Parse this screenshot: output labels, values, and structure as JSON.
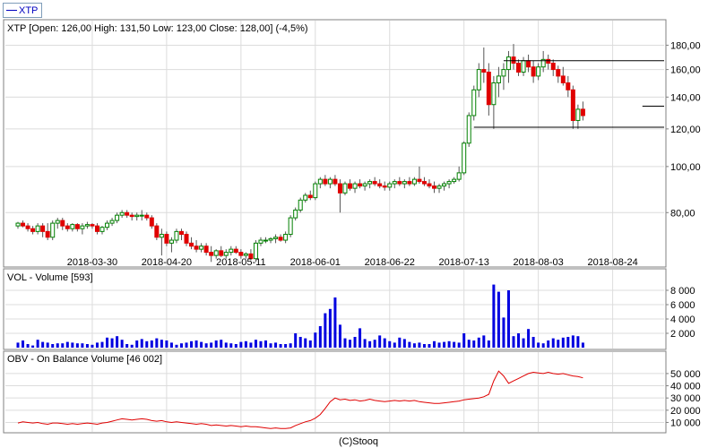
{
  "legend": {
    "label": "XTP",
    "color": "#0000c0"
  },
  "footer_text": "(C)Stooq",
  "colors": {
    "up": "#008000",
    "down": "#e00000",
    "wick": "#555555",
    "volume": "#0000e0",
    "obv": "#e00000",
    "levels": "#000000"
  },
  "chart_data": [
    {
      "type": "candlestick",
      "title": "XTP [Open: 126,00  High: 131,50  Low: 123,00  Close: 128,00] (-4,5%)",
      "scale": "log",
      "ylim": [
        62,
        190
      ],
      "yticks": [
        80,
        100,
        120,
        140,
        160,
        180
      ],
      "ytick_labels": [
        "80,00",
        "100,00",
        "120,00",
        "140,00",
        "160,00",
        "180,00"
      ],
      "xtick_labels": [
        "2018-03-30",
        "2018-04-20",
        "2018-05-11",
        "2018-06-01",
        "2018-06-22",
        "2018-07-13",
        "2018-08-03",
        "2018-08-24"
      ],
      "xtick_index": [
        15,
        30,
        45,
        60,
        75,
        90,
        105,
        120
      ],
      "levels": [
        {
          "value": 167,
          "from_index": 98,
          "to_index": 134
        },
        {
          "value": 134,
          "from_index": 126,
          "to_index": 134
        },
        {
          "value": 121,
          "from_index": 92,
          "to_index": 134
        }
      ],
      "ohlc": [
        [
          75,
          76.5,
          74,
          76
        ],
        [
          76,
          77,
          74.5,
          75
        ],
        [
          75,
          76,
          73,
          74
        ],
        [
          74,
          75,
          72,
          73
        ],
        [
          73,
          76,
          72,
          75
        ],
        [
          75,
          76,
          71,
          73
        ],
        [
          73,
          76,
          70,
          71
        ],
        [
          71,
          77,
          70,
          76
        ],
        [
          76,
          78,
          74,
          77
        ],
        [
          77,
          78,
          73.5,
          75
        ],
        [
          75,
          76,
          73,
          74
        ],
        [
          74,
          76,
          73,
          75.5
        ],
        [
          75.5,
          76,
          73,
          74
        ],
        [
          74,
          76,
          72,
          75
        ],
        [
          75,
          76.5,
          74,
          75.5
        ],
        [
          75.5,
          76,
          74,
          75
        ],
        [
          75,
          76,
          72,
          73
        ],
        [
          73,
          75,
          72,
          74.5
        ],
        [
          74.5,
          77,
          73.5,
          76
        ],
        [
          76,
          78,
          75,
          77
        ],
        [
          77,
          80,
          76,
          79
        ],
        [
          79,
          81,
          78,
          80
        ],
        [
          80,
          81,
          78,
          79
        ],
        [
          79,
          80,
          77,
          78.5
        ],
        [
          78.5,
          80,
          77,
          79
        ],
        [
          79,
          81,
          77,
          79
        ],
        [
          79,
          80,
          77,
          78
        ],
        [
          78,
          79,
          74,
          75
        ],
        [
          75,
          76,
          70,
          71
        ],
        [
          71,
          74,
          65,
          72
        ],
        [
          72,
          73,
          68,
          69
        ],
        [
          69,
          71,
          66,
          70
        ],
        [
          70,
          74,
          69,
          73
        ],
        [
          73,
          74,
          70,
          72
        ],
        [
          72,
          73,
          68,
          69
        ],
        [
          69,
          71,
          67,
          68
        ],
        [
          68,
          70,
          66,
          67
        ],
        [
          67,
          69,
          66,
          68
        ],
        [
          68,
          69,
          65,
          66
        ],
        [
          66,
          68,
          63,
          65
        ],
        [
          65,
          67,
          64,
          66.5
        ],
        [
          66.5,
          68,
          64.5,
          65
        ],
        [
          65,
          67,
          64,
          66
        ],
        [
          66,
          68,
          65,
          67
        ],
        [
          67,
          68,
          65.5,
          66
        ],
        [
          66,
          67,
          64,
          65
        ],
        [
          65,
          66,
          64,
          65.5
        ],
        [
          65.5,
          67,
          63.5,
          64
        ],
        [
          64,
          70,
          63,
          69
        ],
        [
          69,
          71,
          68,
          70
        ],
        [
          70,
          71,
          69,
          70
        ],
        [
          70,
          71,
          69,
          70.5
        ],
        [
          70.5,
          72,
          69,
          71
        ],
        [
          71,
          72,
          69.5,
          70
        ],
        [
          70,
          73,
          69,
          72
        ],
        [
          72,
          79,
          71,
          78
        ],
        [
          78,
          82,
          77,
          81
        ],
        [
          81,
          86,
          80,
          85
        ],
        [
          85,
          88,
          84,
          87
        ],
        [
          87,
          89,
          85,
          86
        ],
        [
          86,
          93,
          85,
          92
        ],
        [
          92,
          95,
          90,
          94
        ],
        [
          94,
          96,
          91,
          92
        ],
        [
          92,
          95,
          90,
          94
        ],
        [
          94,
          96,
          91,
          92
        ],
        [
          92,
          94,
          80,
          88
        ],
        [
          88,
          93,
          87,
          92
        ],
        [
          92,
          94,
          89,
          90
        ],
        [
          90,
          93,
          88,
          92
        ],
        [
          92,
          94,
          90,
          91
        ],
        [
          91,
          93,
          89,
          92
        ],
        [
          92,
          94,
          90,
          93
        ],
        [
          93,
          95,
          91,
          92
        ],
        [
          92,
          94,
          90,
          91
        ],
        [
          91,
          93,
          89,
          90.5
        ],
        [
          90.5,
          93,
          89,
          92
        ],
        [
          92,
          94,
          90,
          93
        ],
        [
          93,
          95,
          91,
          92
        ],
        [
          92,
          94,
          90,
          93
        ],
        [
          93,
          95,
          91,
          92
        ],
        [
          92,
          95,
          91,
          94
        ],
        [
          94,
          100,
          92,
          93
        ],
        [
          93,
          95,
          91,
          92
        ],
        [
          92,
          94,
          90,
          91
        ],
        [
          91,
          93,
          88,
          90
        ],
        [
          90,
          92,
          88,
          91
        ],
        [
          91,
          93,
          89,
          92
        ],
        [
          92,
          94,
          90,
          93
        ],
        [
          93,
          95,
          92,
          94
        ],
        [
          94,
          100,
          93,
          97
        ],
        [
          97,
          113,
          96,
          112
        ],
        [
          112,
          130,
          110,
          128
        ],
        [
          128,
          148,
          125,
          145
        ],
        [
          145,
          165,
          140,
          160
        ],
        [
          160,
          178,
          150,
          158
        ],
        [
          158,
          165,
          128,
          135
        ],
        [
          135,
          155,
          120,
          150
        ],
        [
          150,
          162,
          140,
          155
        ],
        [
          155,
          165,
          145,
          160
        ],
        [
          160,
          175,
          150,
          170
        ],
        [
          170,
          181,
          160,
          165
        ],
        [
          165,
          168,
          155,
          158
        ],
        [
          158,
          170,
          155,
          167
        ],
        [
          167,
          172,
          158,
          162
        ],
        [
          162,
          167,
          150,
          155
        ],
        [
          155,
          165,
          152,
          162
        ],
        [
          162,
          175,
          158,
          168
        ],
        [
          168,
          172,
          160,
          165
        ],
        [
          165,
          168,
          155,
          160
        ],
        [
          160,
          163,
          150,
          155
        ],
        [
          155,
          162,
          148,
          150
        ],
        [
          150,
          155,
          140,
          145
        ],
        [
          145,
          148,
          120,
          125
        ],
        [
          125,
          135,
          120,
          132
        ],
        [
          132,
          137,
          125,
          128
        ]
      ]
    },
    {
      "type": "bar",
      "title": "VOL - Volume [593]",
      "ylim": [
        0,
        9000
      ],
      "yticks": [
        2000,
        4000,
        6000,
        8000
      ],
      "ytick_labels": [
        "2 000",
        "4 000",
        "6 000",
        "8 000"
      ],
      "values": [
        700,
        1000,
        500,
        300,
        1100,
        800,
        700,
        500,
        600,
        600,
        800,
        700,
        600,
        600,
        500,
        400,
        700,
        800,
        1400,
        1300,
        1600,
        1100,
        500,
        400,
        1000,
        1200,
        900,
        1000,
        1300,
        1100,
        1000,
        700,
        400,
        600,
        700,
        900,
        1000,
        800,
        600,
        700,
        1000,
        1100,
        700,
        600,
        500,
        800,
        900,
        700,
        1100,
        900,
        1000,
        600,
        700,
        500,
        500,
        600,
        2000,
        1500,
        1300,
        1000,
        2100,
        3000,
        4800,
        5400,
        7000,
        3200,
        1300,
        1100,
        1500,
        2700,
        1200,
        900,
        1100,
        1700,
        1300,
        900,
        700,
        1400,
        1200,
        800,
        600,
        700,
        500,
        500,
        900,
        700,
        800,
        900,
        800,
        700,
        2000,
        1100,
        1000,
        1400,
        1700,
        1000,
        8800,
        7800,
        4200,
        8000,
        1600,
        2000,
        1300,
        2600,
        1500,
        700,
        600,
        1000,
        1300,
        1100,
        1400,
        1500,
        1700,
        1600,
        700
      ]
    },
    {
      "type": "line",
      "title": "OBV - On Balance Volume [46 002]",
      "ylim": [
        3000,
        58000
      ],
      "yticks": [
        10000,
        20000,
        30000,
        40000,
        50000
      ],
      "ytick_labels": [
        "10 000",
        "20 000",
        "30 000",
        "40 000",
        "50 000"
      ],
      "values": [
        9500,
        10500,
        10000,
        9500,
        10000,
        9000,
        8500,
        9500,
        9500,
        9000,
        8500,
        9000,
        8500,
        9000,
        9500,
        9000,
        8500,
        9500,
        10000,
        11000,
        12000,
        13000,
        12500,
        12000,
        12500,
        13000,
        12500,
        11500,
        11000,
        11500,
        10500,
        10000,
        10500,
        10000,
        9500,
        9000,
        8500,
        9000,
        8500,
        7500,
        8000,
        7500,
        7000,
        7500,
        7000,
        6500,
        7000,
        6500,
        6500,
        6000,
        5500,
        5000,
        5500,
        5000,
        5000,
        5500,
        7500,
        9000,
        10500,
        11500,
        13500,
        16500,
        21500,
        27000,
        30000,
        28500,
        29000,
        28000,
        28500,
        27500,
        28000,
        29000,
        28000,
        27500,
        27000,
        27500,
        28000,
        27500,
        28000,
        27500,
        28000,
        27000,
        26500,
        26000,
        25500,
        25500,
        26000,
        26500,
        27000,
        27500,
        28500,
        29000,
        29500,
        30000,
        31000,
        33000,
        44000,
        52000,
        48000,
        42000,
        44000,
        46000,
        48000,
        50000,
        51000,
        50500,
        50000,
        51000,
        50000,
        49500,
        50000,
        49000,
        48000,
        47500,
        46500
      ]
    }
  ]
}
